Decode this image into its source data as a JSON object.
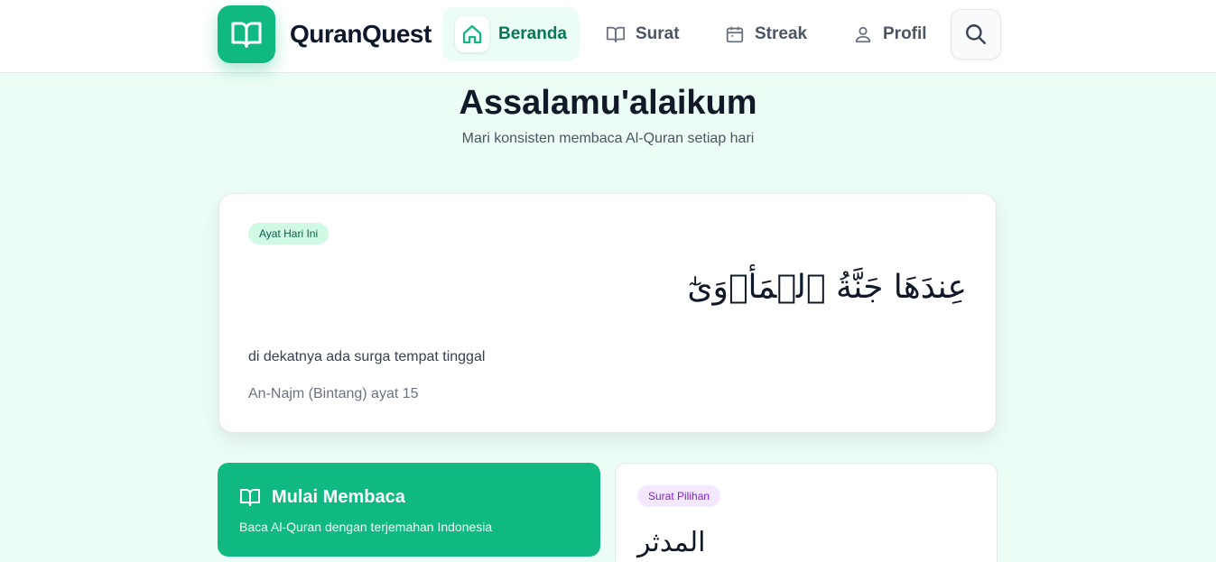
{
  "app": {
    "name": "QuranQuest"
  },
  "nav": {
    "items": [
      {
        "label": "Beranda",
        "icon": "home-icon",
        "active": true
      },
      {
        "label": "Surat",
        "icon": "book-icon",
        "active": false
      },
      {
        "label": "Streak",
        "icon": "calendar-icon",
        "active": false
      },
      {
        "label": "Profil",
        "icon": "user-icon",
        "active": false
      }
    ],
    "search_icon": "search-icon"
  },
  "greeting": {
    "title": "Assalamu'alaikum",
    "subtitle": "Mari konsisten membaca Al-Quran setiap hari"
  },
  "verse_of_day": {
    "badge": "Ayat Hari Ini",
    "arabic": "عِندَهَا جَنَّةُ ٱلۡمَأۡوَىٰٓ",
    "translation": "di dekatnya ada surga tempat tinggal",
    "reference": "An-Najm (Bintang) ayat 15"
  },
  "start_reading": {
    "title": "Mulai Membaca",
    "description": "Baca Al-Quran dengan terjemahan Indonesia"
  },
  "featured_surah": {
    "badge": "Surat Pilihan",
    "arabic": "المدثر"
  },
  "colors": {
    "primary": "#10b981",
    "background": "#ecfdf5",
    "badge_purple": "#f3e8ff"
  }
}
